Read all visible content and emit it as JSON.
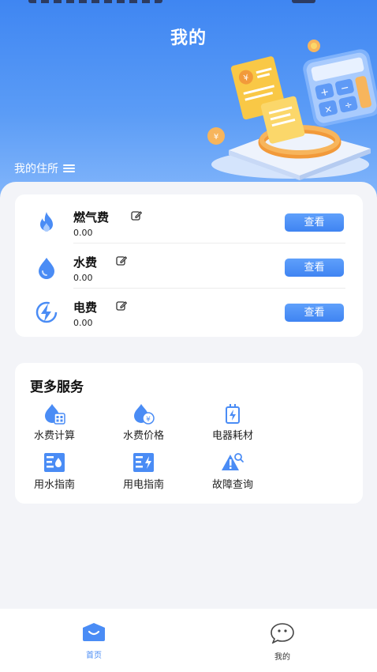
{
  "header": {
    "title": "我的",
    "residence_label": "我的住所"
  },
  "bills": [
    {
      "name": "燃气费",
      "amount": "0.00",
      "button": "查看",
      "icon": "flame-icon"
    },
    {
      "name": "水费",
      "amount": "0.00",
      "button": "查看",
      "icon": "water-drop-icon"
    },
    {
      "name": "电费",
      "amount": "0.00",
      "button": "查看",
      "icon": "lightning-icon"
    }
  ],
  "services": {
    "title": "更多服务",
    "items": [
      {
        "label": "水费计算",
        "icon": "water-calculator-icon"
      },
      {
        "label": "水费价格",
        "icon": "water-price-icon"
      },
      {
        "label": "电器耗材",
        "icon": "battery-icon"
      },
      {
        "label": "用水指南",
        "icon": "water-guide-icon"
      },
      {
        "label": "用电指南",
        "icon": "electric-guide-icon"
      },
      {
        "label": "故障查询",
        "icon": "fault-search-icon"
      }
    ]
  },
  "tabbar": {
    "home_label": "首页",
    "mine_label": "我的"
  },
  "colors": {
    "primary": "#3f84f2",
    "accent_light": "#86b8fb",
    "background": "#f3f4f8"
  }
}
